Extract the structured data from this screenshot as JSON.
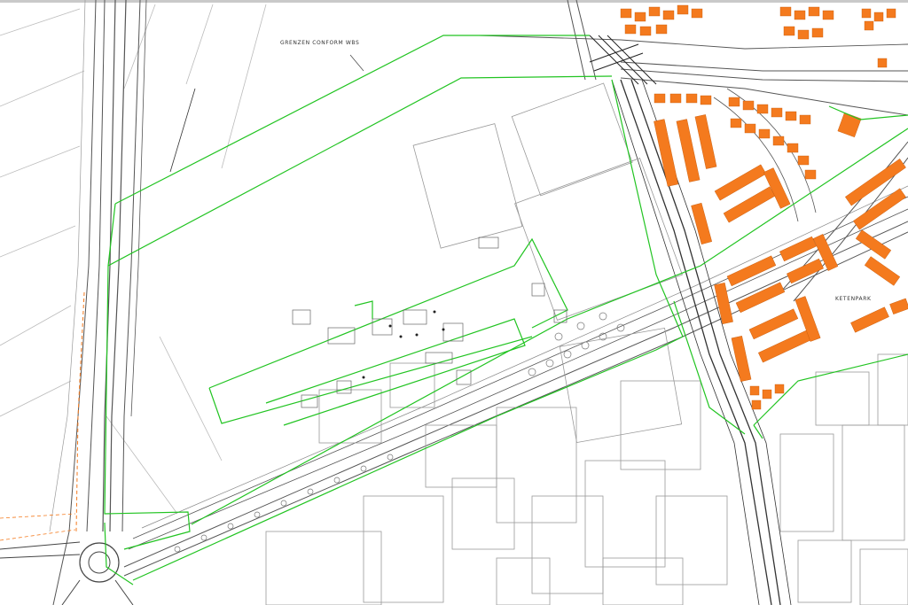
{
  "map": {
    "labels": {
      "boundary_note": "GRENZEN CONFORM WBS",
      "park": "KETENPARK"
    },
    "colors": {
      "boundary": "#22c422",
      "buildings": "#f47a1e",
      "linework": "#6a6a6a",
      "road": "#444444",
      "background": "#ffffff",
      "survey_dash": "#f47a1e"
    }
  }
}
